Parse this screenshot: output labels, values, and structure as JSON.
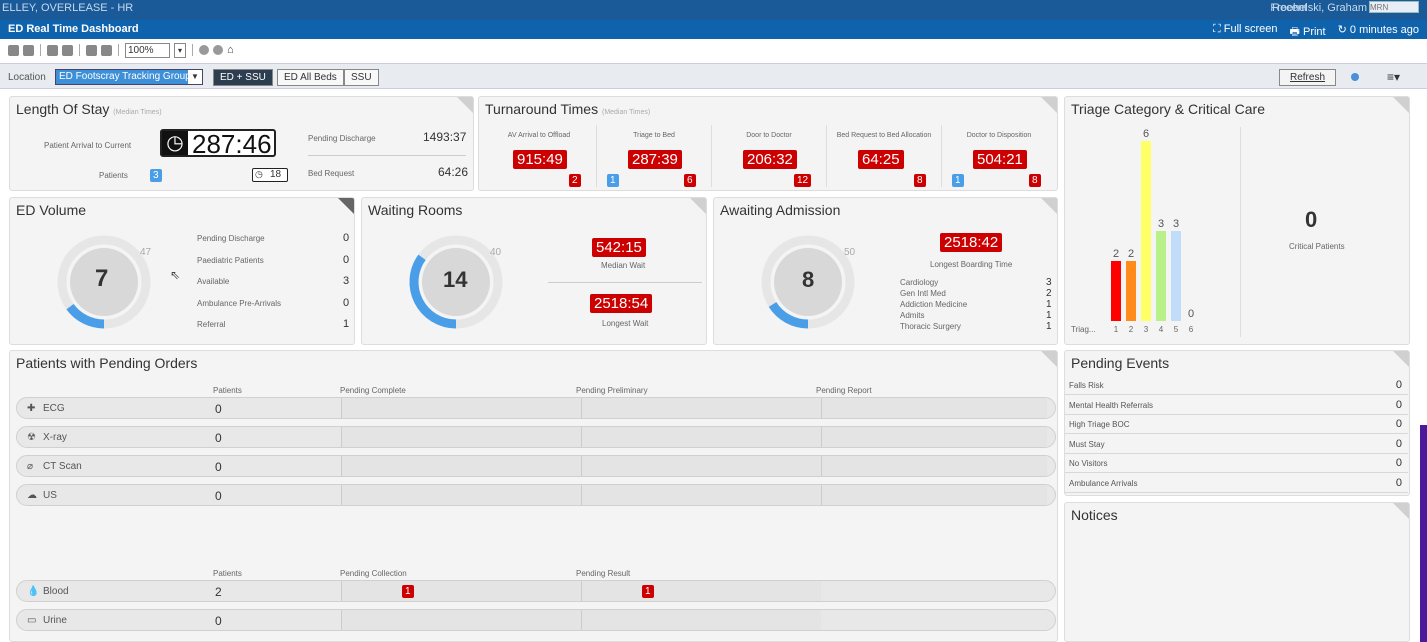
{
  "topstrip": {
    "left": "ELLEY, OVERLEASE - HR",
    "right": "Froehelski, Graham",
    "recent": "Recent",
    "search_placeholder": "MRN"
  },
  "titlebar": {
    "title": "ED Real Time Dashboard",
    "fullscreen": "Full screen",
    "print": "Print",
    "updated": "0 minutes ago"
  },
  "toolbar": {
    "zoom": "100%"
  },
  "location": {
    "label": "Location",
    "group": "ED Footscray Tracking Group",
    "tabs": [
      "ED + SSU",
      "ED All Beds",
      "SSU"
    ],
    "refresh": "Refresh"
  },
  "los": {
    "title": "Length Of Stay",
    "sub": "(Median Times)",
    "arrival_label": "Patient Arrival to Current",
    "arrival_value": "287:46",
    "patients_label": "Patients",
    "patients": "3",
    "clock_count": "18",
    "pending_discharge_label": "Pending Discharge",
    "pending_discharge": "1493:37",
    "bed_request_label": "Bed Request",
    "bed_request": "64:26"
  },
  "tat": {
    "title": "Turnaround Times",
    "sub": "(Median Times)",
    "cols": [
      {
        "label": "AV Arrival to Offload",
        "value": "915:49",
        "blue": "",
        "red": "2"
      },
      {
        "label": "Triage to Bed",
        "value": "287:39",
        "blue": "1",
        "red": "6"
      },
      {
        "label": "Door to Doctor",
        "value": "206:32",
        "blue": "",
        "red": "12"
      },
      {
        "label": "Bed Request to Bed Allocation",
        "value": "64:25",
        "blue": "",
        "red": "8"
      },
      {
        "label": "Doctor to Disposition",
        "value": "504:21",
        "blue": "1",
        "red": "8"
      }
    ]
  },
  "triage": {
    "title": "Triage Category & Critical Care",
    "critical_value": "0",
    "critical_label": "Critical Patients",
    "axis_label": "Triag..."
  },
  "chart_data": {
    "type": "bar",
    "categories": [
      "1",
      "2",
      "3",
      "4",
      "5",
      "6"
    ],
    "values": [
      2,
      2,
      6,
      3,
      3,
      0
    ],
    "colors": [
      "#ff0000",
      "#ff8c1a",
      "#ffff66",
      "#b8f08a",
      "#c0dcf8",
      "#cccccc"
    ],
    "ylim": [
      0,
      6
    ]
  },
  "edvol": {
    "title": "ED Volume",
    "value": "7",
    "max": "47",
    "fill": 0.15,
    "rows": [
      {
        "l": "Pending Discharge",
        "v": "0"
      },
      {
        "l": "Paediatric Patients",
        "v": "0"
      },
      {
        "l": "Available",
        "v": "3"
      },
      {
        "l": "Ambulance Pre-Arrivals",
        "v": "0"
      },
      {
        "l": "Referral",
        "v": "1"
      }
    ]
  },
  "wait": {
    "title": "Waiting Rooms",
    "value": "14",
    "max": "40",
    "fill": 0.35,
    "median": "542:15",
    "median_label": "Median Wait",
    "longest": "2518:54",
    "longest_label": "Longest Wait"
  },
  "adm": {
    "title": "Awaiting Admission",
    "value": "8",
    "max": "50",
    "fill": 0.16,
    "longest": "2518:42",
    "longest_label": "Longest Boarding Time",
    "rows": [
      {
        "l": "Cardiology",
        "v": "3"
      },
      {
        "l": "Gen Intl Med",
        "v": "2"
      },
      {
        "l": "Addiction Medicine",
        "v": "1"
      },
      {
        "l": "Admits",
        "v": "1"
      },
      {
        "l": "Thoracic Surgery",
        "v": "1"
      }
    ]
  },
  "orders": {
    "title": "Patients with Pending Orders",
    "headers1": [
      "Patients",
      "Pending Complete",
      "Pending Preliminary",
      "Pending Report"
    ],
    "rows1": [
      {
        "icon": "ECG",
        "v": "0"
      },
      {
        "icon": "X-ray",
        "v": "0"
      },
      {
        "icon": "CT Scan",
        "v": "0"
      },
      {
        "icon": "US",
        "v": "0"
      }
    ],
    "headers2": [
      "Patients",
      "Pending Collection",
      "Pending Result"
    ],
    "rows2": [
      {
        "icon": "Blood",
        "v": "2",
        "c": "1",
        "r": "1"
      },
      {
        "icon": "Urine",
        "v": "0",
        "c": "",
        "r": ""
      }
    ]
  },
  "events": {
    "title": "Pending Events",
    "rows": [
      {
        "l": "Falls Risk",
        "v": "0"
      },
      {
        "l": "Mental Health Referrals",
        "v": "0"
      },
      {
        "l": "High Triage BOC",
        "v": "0"
      },
      {
        "l": "Must Stay",
        "v": "0"
      },
      {
        "l": "No Visitors",
        "v": "0"
      },
      {
        "l": "Ambulance Arrivals",
        "v": "0"
      }
    ]
  },
  "notices": {
    "title": "Notices"
  }
}
